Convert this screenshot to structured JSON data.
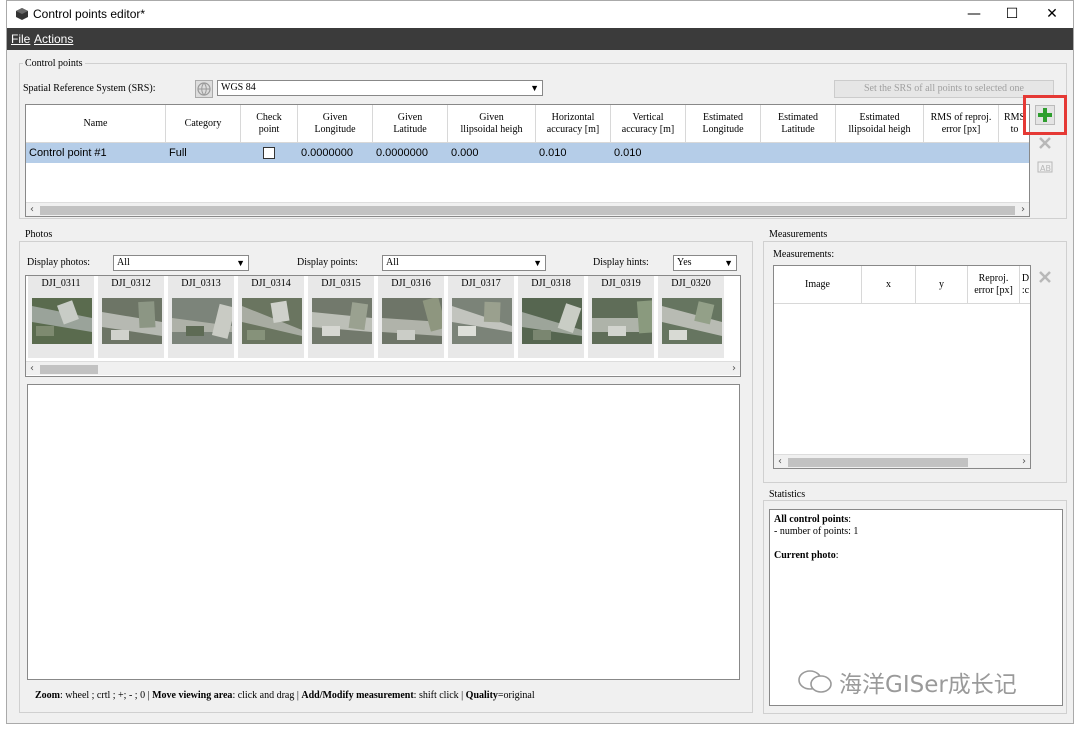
{
  "window": {
    "title": "Control points editor*",
    "controls": {
      "minimize": "—",
      "maximize": "☐",
      "close": "✕"
    }
  },
  "menu": {
    "file": "File",
    "actions": "Actions"
  },
  "control_points": {
    "group_label": "Control points",
    "srs_label": "Spatial Reference System (SRS):",
    "srs_value": "WGS 84",
    "set_srs_button": "Set the SRS of all points to selected one",
    "columns": [
      "Name",
      "Category",
      "Check\npoint",
      "Given\nLongitude",
      "Given\nLatitude",
      "Given\nllipsoidal heigh",
      "Horizontal\naccuracy [m]",
      "Vertical\naccuracy [m]",
      "Estimated\nLongitude",
      "Estimated\nLatitude",
      "Estimated\nllipsoidal heigh",
      "RMS of reproj.\nerror [px]",
      "RMS\nto"
    ],
    "rows": [
      {
        "name": "Control point #1",
        "category": "Full",
        "check": "",
        "given_lon": "0.0000000",
        "given_lat": "0.0000000",
        "given_h": "0.000",
        "h_acc": "0.010",
        "v_acc": "0.010"
      }
    ],
    "add_icon": "plus-icon",
    "remove_icon": "delete-icon",
    "rename_icon": "rename-icon"
  },
  "photos": {
    "group_label": "Photos",
    "display_photos_label": "Display photos:",
    "display_photos_value": "All",
    "display_points_label": "Display points:",
    "display_points_value": "All",
    "display_hints_label": "Display hints:",
    "display_hints_value": "Yes",
    "thumbnails": [
      "DJI_0311",
      "DJI_0312",
      "DJI_0313",
      "DJI_0314",
      "DJI_0315",
      "DJI_0316",
      "DJI_0317",
      "DJI_0318",
      "DJI_0319",
      "DJI_0320"
    ]
  },
  "status_bar": {
    "zoom_key": "Zoom",
    "zoom_val": ": wheel ; crtl ; +; - ; 0 |",
    "move_key": "Move viewing area",
    "move_val": ": click and drag |",
    "add_key": "Add/Modify measurement",
    "add_val": ": shift click |",
    "quality_key": "Quality",
    "quality_val": "=original"
  },
  "measurements": {
    "group_label": "Measurements",
    "sub_label": "Measurements:",
    "columns": [
      "Image",
      "x",
      "y",
      "Reproj.\nerror [px]",
      "D\n:c"
    ]
  },
  "statistics": {
    "group_label": "Statistics",
    "all_title": "All control points",
    "all_colon": ":",
    "num_points": "- number of points: 1",
    "current_title": "Current photo",
    "current_colon": ":"
  },
  "watermark": "海洋GISer成长记",
  "colors": {
    "selected_row": "#b5cde8",
    "menubar": "#3b3b3b",
    "highlight": "#e53935",
    "plus": "#2e9e2e"
  }
}
